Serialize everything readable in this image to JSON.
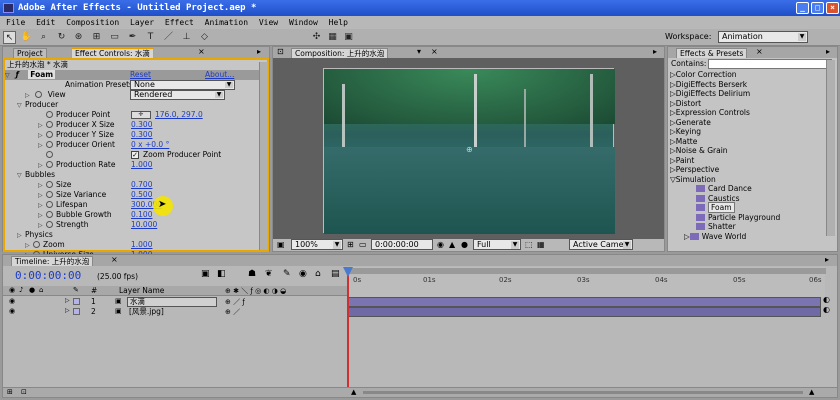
{
  "window": {
    "title": "Adobe After Effects - Untitled Project.aep *"
  },
  "menu": [
    "File",
    "Edit",
    "Composition",
    "Layer",
    "Effect",
    "Animation",
    "View",
    "Window",
    "Help"
  ],
  "toolbar": {
    "workspace_label": "Workspace:",
    "workspace_value": "Animation"
  },
  "left_panel": {
    "tab_project": "Project",
    "tab_effect_controls": "Effect Controls: 水滴",
    "header": "上升的水泡 * 水滴",
    "effect_name": "Foam",
    "reset_label": "Reset",
    "about_label": "About...",
    "animation_presets_label": "Animation Presets:",
    "animation_presets_value": "None",
    "view_label": "View",
    "view_value": "Rendered",
    "params": [
      {
        "label": "Producer",
        "value": ""
      },
      {
        "label": "Producer Point",
        "value": "176.0, 297.0"
      },
      {
        "label": "Producer X Size",
        "value": "0.300"
      },
      {
        "label": "Producer Y Size",
        "value": "0.300"
      },
      {
        "label": "Producer Orient",
        "value": "0 x +0.0 °"
      },
      {
        "label": "Zoom Producer Point",
        "value": ""
      },
      {
        "label": "Production Rate",
        "value": "1.000"
      },
      {
        "label": "Bubbles",
        "value": ""
      },
      {
        "label": "Size",
        "value": "0.700"
      },
      {
        "label": "Size Variance",
        "value": "0.500"
      },
      {
        "label": "Lifespan",
        "value": "300.000"
      },
      {
        "label": "Bubble Growth",
        "value": "0.100"
      },
      {
        "label": "Strength",
        "value": "10.000"
      },
      {
        "label": "Physics",
        "value": ""
      },
      {
        "label": "Zoom",
        "value": "1.000"
      },
      {
        "label": "Universe Size",
        "value": "1.000"
      }
    ]
  },
  "composition": {
    "tab": "Composition: 上升的水泡",
    "zoom": "100%",
    "timecode": "0:00:00:00",
    "quality": "Full",
    "camera": "Active Camera"
  },
  "effects_presets": {
    "tab": "Effects & Presets",
    "contains_label": "Contains:",
    "items": [
      "Color Correction",
      "DigiEffects Berserk",
      "DigiEffects Delirium",
      "Distort",
      "Expression Controls",
      "Generate",
      "Keying",
      "Matte",
      "Noise & Grain",
      "Paint",
      "Perspective",
      "Simulation"
    ],
    "sub_items": [
      "Card Dance",
      "Caustics",
      "Foam",
      "Particle Playground",
      "Shatter",
      "Wave World"
    ]
  },
  "timeline": {
    "tab": "Timeline: 上升的水泡",
    "timecode": "0:00:00:00",
    "fps": "(25.00 fps)",
    "column_layer_name": "Layer Name",
    "column_num": "#",
    "ruler": [
      "0s",
      "01s",
      "02s",
      "03s",
      "04s",
      "05s",
      "06s"
    ],
    "layers": [
      {
        "num": "1",
        "name": "水滴"
      },
      {
        "num": "2",
        "name": "[风景.jpg]"
      }
    ]
  },
  "colors": {
    "title_blue": "#2a5ad9",
    "panel": "#c4c4c4",
    "link_blue": "#1c3cc8",
    "track_purple": "#7a74b0"
  }
}
